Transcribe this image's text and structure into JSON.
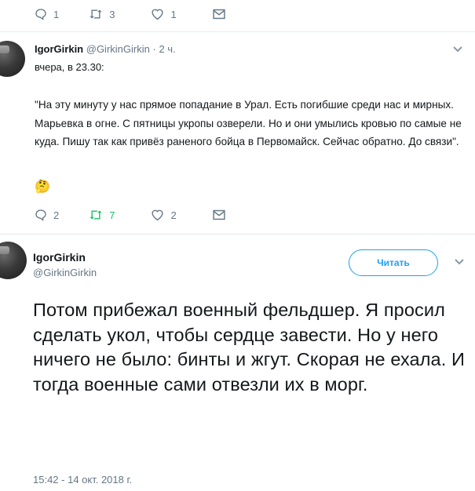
{
  "top_actions": {
    "reply_count": "1",
    "retweet_count": "3",
    "like_count": "1"
  },
  "reply_tweet": {
    "author_name": "IgorGirkin",
    "author_handle": "@GirkinGirkin",
    "separator": "·",
    "time_ago": "2 ч.",
    "intro": "вчера, в 23.30:",
    "body": "\"На эту минуту у нас прямое попадание в Урал. Есть погибшие среди нас и мирных. Марьевка в огне. С пятницы укропы озверели. Но и они умылись кровью по самые не куда. Пишу так как привёз раненого бойца в Первомайск. Сейчас обратно. До связи\".",
    "emoji": "🤔",
    "reply_count": "2",
    "retweet_count": "7",
    "like_count": "2"
  },
  "main_tweet": {
    "author_name": "IgorGirkin",
    "author_handle": "@GirkinGirkin",
    "follow_label": "Читать",
    "body": "Потом прибежал военный фельдшер. Я просил сделать укол, чтобы сердце завести. Но у него ничего не было: бинты и жгут. Скорая не ехала. И тогда военные сами отвезли их в морг.",
    "timestamp": "15:42 - 14 окт. 2018 г."
  },
  "colors": {
    "accent": "#1da1f2",
    "retweet_active": "#17bf63",
    "muted": "#657786",
    "divider": "#e6ecf0"
  }
}
